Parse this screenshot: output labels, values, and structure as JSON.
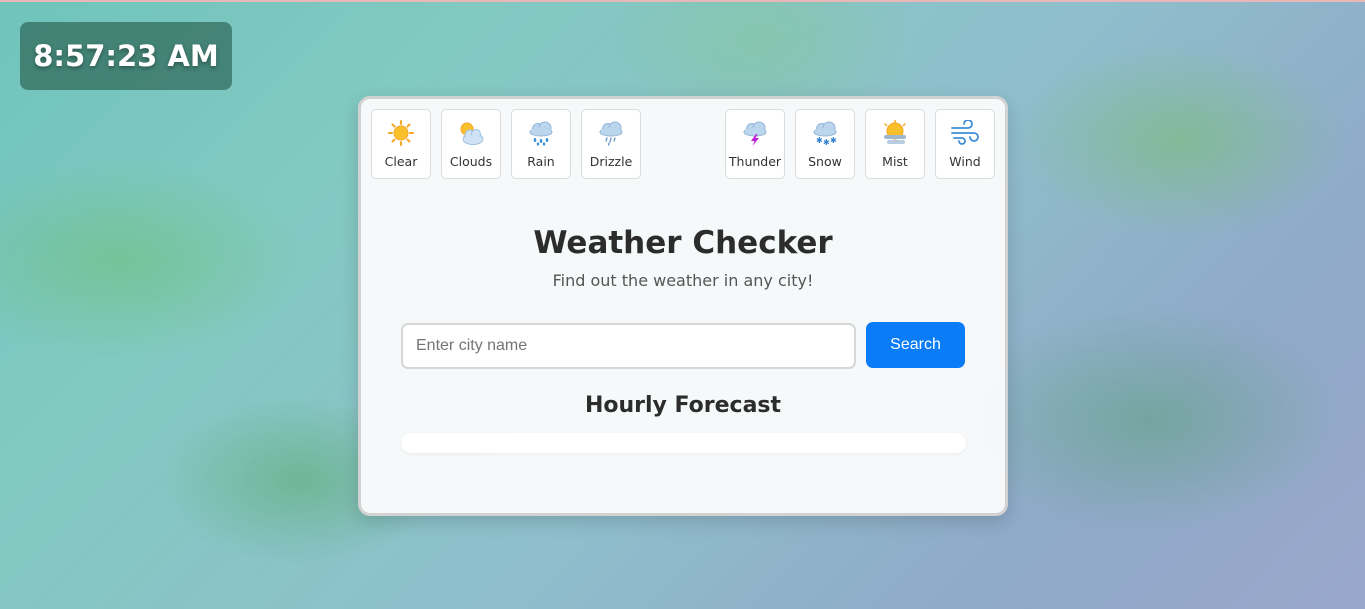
{
  "clock": {
    "time": "8:57:23 AM"
  },
  "weather_types": [
    {
      "label": "Clear",
      "icon": "sun-icon"
    },
    {
      "label": "Clouds",
      "icon": "sun-cloud-icon"
    },
    {
      "label": "Rain",
      "icon": "rain-cloud-icon"
    },
    {
      "label": "Drizzle",
      "icon": "drizzle-cloud-icon"
    },
    {
      "label": "Thunder",
      "icon": "thunder-cloud-icon"
    },
    {
      "label": "Snow",
      "icon": "snow-cloud-icon"
    },
    {
      "label": "Mist",
      "icon": "mist-icon"
    },
    {
      "label": "Wind",
      "icon": "wind-icon"
    }
  ],
  "header": {
    "title": "Weather Checker",
    "subtitle": "Find out the weather in any city!"
  },
  "search": {
    "placeholder": "Enter city name",
    "value": "",
    "button_label": "Search"
  },
  "forecast": {
    "title": "Hourly Forecast"
  },
  "colors": {
    "accent": "#0a7cf8",
    "card_bg": "#fafbfc",
    "clock_bg": "#285f50"
  }
}
